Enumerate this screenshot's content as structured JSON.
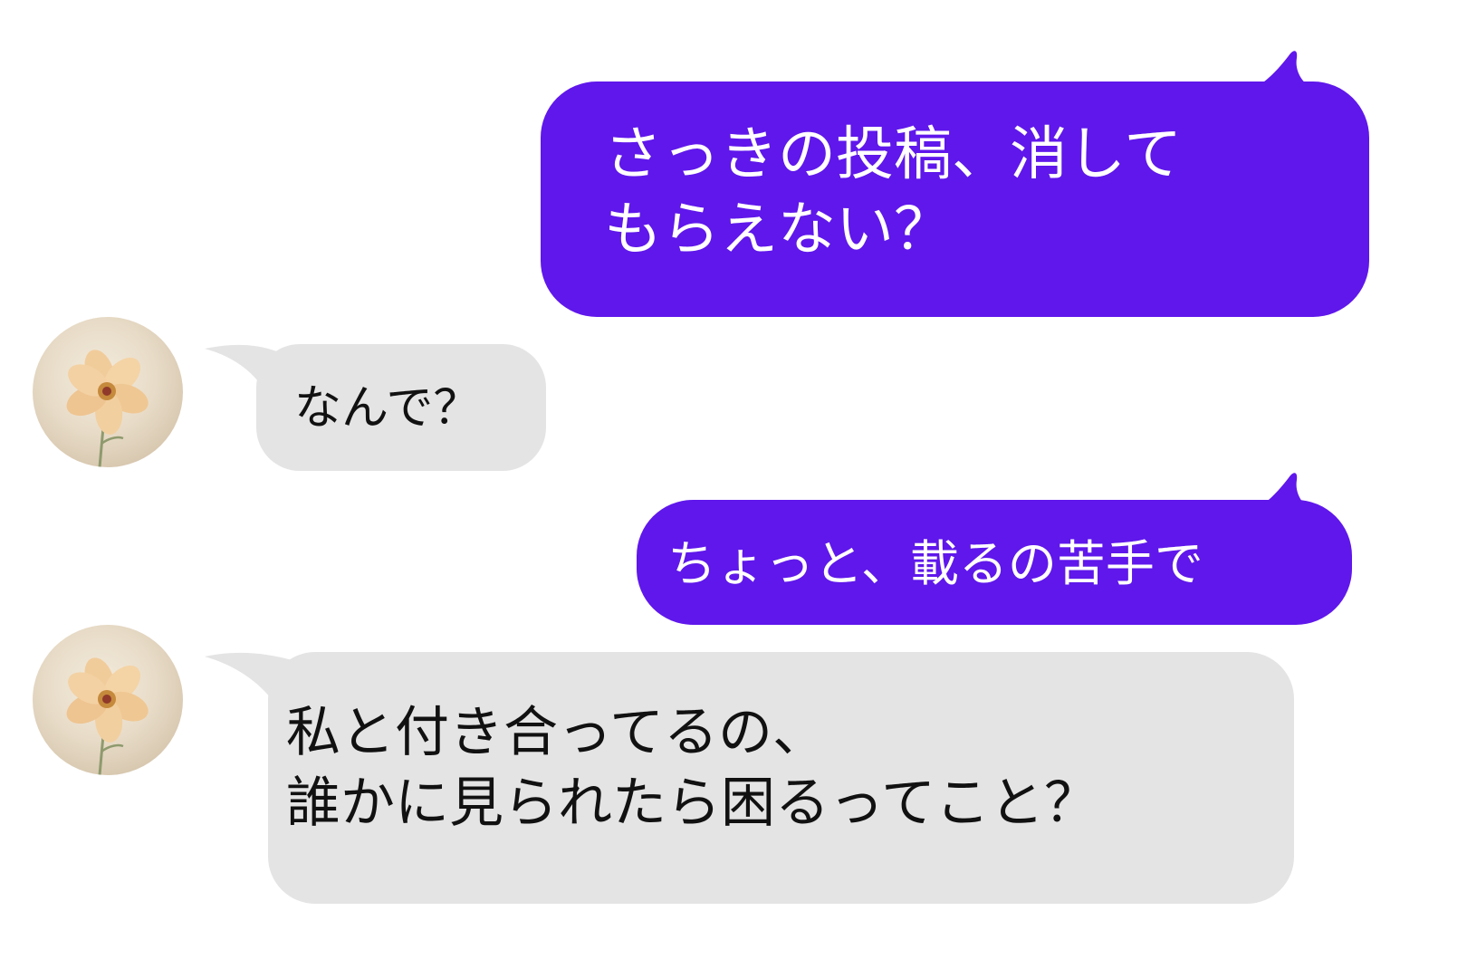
{
  "colors": {
    "sent_bubble": "#5F17EB",
    "received_bubble": "#E4E4E4",
    "sent_text": "#FFFFFF",
    "received_text": "#111111",
    "background": "#FFFFFF"
  },
  "contact": {
    "avatar_icon": "flower-avatar-icon"
  },
  "messages": [
    {
      "sender": "me",
      "text": "さっきの投稿、消して\nもらえない？"
    },
    {
      "sender": "contact",
      "text": "なんで？"
    },
    {
      "sender": "me",
      "text": "ちょっと、載るの苦手で"
    },
    {
      "sender": "contact",
      "text": "私と付き合ってるの、\n誰かに見られたら困るってこと？"
    }
  ]
}
